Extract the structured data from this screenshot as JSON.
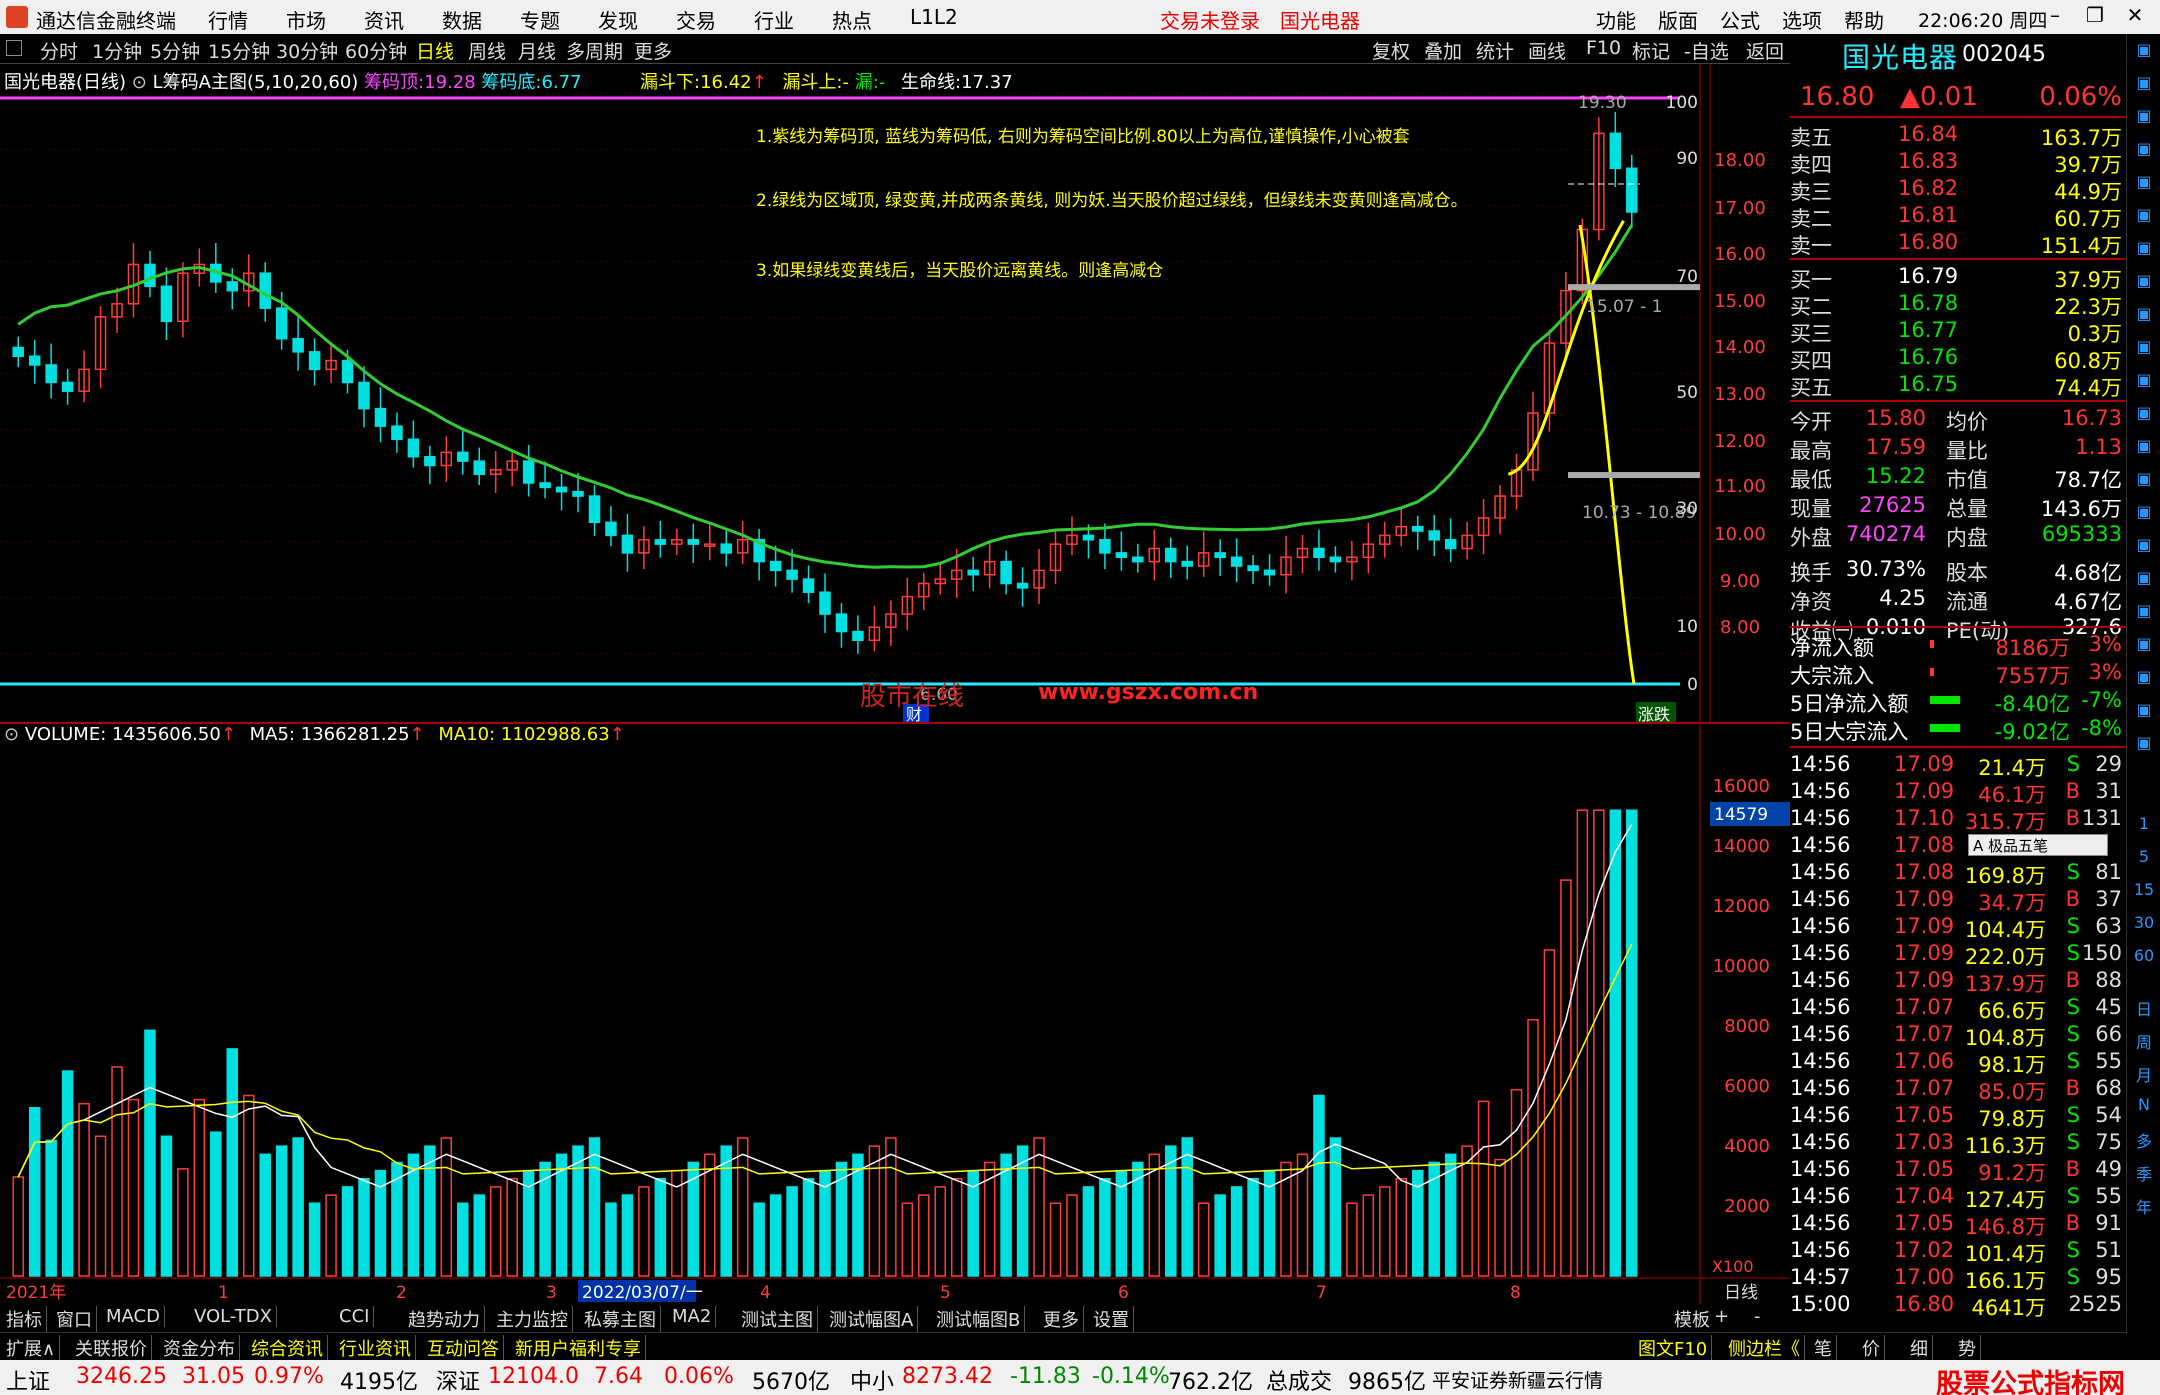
{
  "title_bar": {
    "app_name": "通达信金融终端",
    "menus": [
      "行情",
      "市场",
      "资讯",
      "数据",
      "专题",
      "发现",
      "交易",
      "行业",
      "热点",
      "L1L2"
    ],
    "status": "交易未登录",
    "stock": "国光电器",
    "right_menus": [
      "功能",
      "版面",
      "公式",
      "选项",
      "帮助"
    ],
    "time": "22:06:20",
    "weekday": "周四"
  },
  "toolbar": {
    "periods": [
      "分时",
      "1分钟",
      "5分钟",
      "15分钟",
      "30分钟",
      "60分钟",
      "日线",
      "周线",
      "月线",
      "多周期",
      "更多"
    ],
    "active": "日线",
    "right_buttons": [
      "复权",
      "叠加",
      "统计",
      "画线",
      "F10",
      "标记",
      "-自选",
      "返回"
    ]
  },
  "main_legend": {
    "stock_label": "国光电器(日线)",
    "indicator": "L筹码A主图(5,10,20,60)",
    "chip_top_label": "筹码顶:",
    "chip_top": "19.28",
    "chip_bottom_label": "筹码底:",
    "chip_bottom": "6.77",
    "funnel_low_label": "漏斗下:",
    "funnel_low": "16.42",
    "funnel_high": "漏斗上:-",
    "funnel": "漏:-",
    "life_line_label": "生命线:",
    "life_line": "17.37"
  },
  "notes": [
    "1.紫线为筹码顶, 蓝线为筹码低, 右则为筹码空间比例.80以上为高位,谨慎操作,小心被套",
    "2.绿线为区域顶, 绿变黄,并成两条黄线, 则为妖.当天股价超过绿线，但绿线未变黄则逢高减仓。",
    "3.如果绿线变黄线后，当天股价远离黄线。则逢高减仓"
  ],
  "main_annotations": {
    "peak": "19.30",
    "low": "6.60",
    "low_tag": "财",
    "mid_range": "10.73 - 10.89",
    "upper_range": "15.07 - 1",
    "end_tag": "涨跌",
    "watermark": "股市在线",
    "url": "www.gszx.com.cn"
  },
  "price_axis": [
    "18.00",
    "17.00",
    "16.00",
    "15.00",
    "14.00",
    "13.00",
    "12.00",
    "11.00",
    "10.00",
    "9.00",
    "8.00"
  ],
  "ratio_axis": [
    "100",
    "90",
    "70",
    "50",
    "30",
    "10",
    "0"
  ],
  "volume_legend": {
    "label": "VOLUME:",
    "value": "1435606.50",
    "ma5_label": "MA5:",
    "ma5": "1366281.25",
    "ma10_label": "MA10:",
    "ma10": "1102988.63"
  },
  "volume_axis": [
    "16000",
    "14000",
    "12000",
    "10000",
    "8000",
    "6000",
    "4000",
    "2000"
  ],
  "volume_badge": "14579",
  "volume_unit": "X100",
  "date_axis": [
    "2021年",
    "1",
    "2",
    "3",
    "2022/03/07/一",
    "4",
    "5",
    "6",
    "7",
    "8"
  ],
  "date_axis_label": "日线",
  "chart_data": {
    "type": "candlestick",
    "ylim": [
      6.0,
      19.5
    ],
    "note": "daily candles; price in yuan",
    "closes": [
      13.5,
      13.3,
      12.9,
      12.7,
      13.2,
      14.4,
      14.7,
      15.6,
      15.1,
      14.3,
      15.4,
      15.6,
      15.2,
      15.0,
      15.4,
      14.6,
      13.9,
      13.6,
      13.2,
      13.4,
      12.9,
      12.3,
      11.9,
      11.6,
      11.2,
      11.0,
      11.3,
      11.1,
      10.8,
      10.9,
      11.1,
      10.6,
      10.5,
      10.4,
      10.3,
      9.7,
      9.4,
      9.0,
      9.3,
      9.2,
      9.3,
      9.2,
      9.2,
      9.0,
      9.3,
      8.8,
      8.6,
      8.4,
      8.1,
      7.6,
      7.2,
      7.0,
      7.3,
      7.6,
      8.0,
      8.3,
      8.4,
      8.6,
      8.5,
      8.8,
      8.3,
      8.2,
      8.6,
      9.2,
      9.4,
      9.3,
      9.0,
      8.9,
      8.8,
      9.1,
      8.8,
      8.7,
      9.0,
      8.9,
      8.7,
      8.6,
      8.5,
      8.9,
      9.1,
      8.9,
      8.8,
      8.9,
      9.2,
      9.4,
      9.6,
      9.5,
      9.3,
      9.1,
      9.4,
      9.8,
      10.3,
      10.9,
      12.2,
      13.8,
      15.0,
      16.4,
      18.6,
      17.8,
      16.8
    ],
    "life_line_label": "生命线"
  },
  "quote": {
    "name": "国光电器",
    "code": "002045",
    "price": "16.80",
    "change": "▲0.01",
    "pct": "0.06%",
    "asks": [
      {
        "label": "卖五",
        "price": "16.84",
        "vol": "163.7万"
      },
      {
        "label": "卖四",
        "price": "16.83",
        "vol": "39.7万"
      },
      {
        "label": "卖三",
        "price": "16.82",
        "vol": "44.9万"
      },
      {
        "label": "卖二",
        "price": "16.81",
        "vol": "60.7万"
      },
      {
        "label": "卖一",
        "price": "16.80",
        "vol": "151.4万"
      }
    ],
    "bids": [
      {
        "label": "买一",
        "price": "16.79",
        "vol": "37.9万"
      },
      {
        "label": "买二",
        "price": "16.78",
        "vol": "22.3万"
      },
      {
        "label": "买三",
        "price": "16.77",
        "vol": "0.3万"
      },
      {
        "label": "买四",
        "price": "16.76",
        "vol": "60.8万"
      },
      {
        "label": "买五",
        "price": "16.75",
        "vol": "74.4万"
      }
    ],
    "stats": [
      {
        "l1": "今开",
        "v1": "15.80",
        "l2": "均价",
        "v2": "16.73"
      },
      {
        "l1": "最高",
        "v1": "17.59",
        "l2": "量比",
        "v2": "1.13"
      },
      {
        "l1": "最低",
        "v1": "15.22",
        "l2": "市值",
        "v2": "78.7亿"
      },
      {
        "l1": "现量",
        "v1": "27625",
        "l2": "总量",
        "v2": "143.6万"
      },
      {
        "l1": "外盘",
        "v1": "740274",
        "l2": "内盘",
        "v2": "695333"
      },
      {
        "l1": "换手",
        "v1": "30.73%",
        "l2": "股本",
        "v2": "4.68亿"
      },
      {
        "l1": "净资",
        "v1": "4.25",
        "l2": "流通",
        "v2": "4.67亿"
      },
      {
        "l1": "收益㈠",
        "v1": "0.010",
        "l2": "PE(动)",
        "v2": "327.6"
      }
    ],
    "flows": [
      {
        "label": "净流入额",
        "value": "8186万",
        "pct": "3%"
      },
      {
        "label": "大宗流入",
        "value": "7557万",
        "pct": "3%"
      },
      {
        "label": "5日净流入额",
        "value": "-8.40亿",
        "pct": "-7%"
      },
      {
        "label": "5日大宗流入",
        "value": "-9.02亿",
        "pct": "-8%"
      }
    ],
    "ticks": [
      {
        "t": "14:56",
        "p": "17.09",
        "v": "21.4万",
        "s": "S",
        "n": "29"
      },
      {
        "t": "14:56",
        "p": "17.09",
        "v": "46.1万",
        "s": "B",
        "n": "31"
      },
      {
        "t": "14:56",
        "p": "17.10",
        "v": "315.7万",
        "s": "B",
        "n": "131"
      },
      {
        "t": "14:56",
        "p": "17.08",
        "v": "",
        "s": "",
        "n": ""
      },
      {
        "t": "14:56",
        "p": "17.08",
        "v": "169.8万",
        "s": "S",
        "n": "81"
      },
      {
        "t": "14:56",
        "p": "17.09",
        "v": "34.7万",
        "s": "B",
        "n": "37"
      },
      {
        "t": "14:56",
        "p": "17.09",
        "v": "104.4万",
        "s": "S",
        "n": "63"
      },
      {
        "t": "14:56",
        "p": "17.09",
        "v": "222.0万",
        "s": "S",
        "n": "150"
      },
      {
        "t": "14:56",
        "p": "17.09",
        "v": "137.9万",
        "s": "B",
        "n": "88"
      },
      {
        "t": "14:56",
        "p": "17.07",
        "v": "66.6万",
        "s": "S",
        "n": "45"
      },
      {
        "t": "14:56",
        "p": "17.07",
        "v": "104.8万",
        "s": "S",
        "n": "66"
      },
      {
        "t": "14:56",
        "p": "17.06",
        "v": "98.1万",
        "s": "S",
        "n": "55"
      },
      {
        "t": "14:56",
        "p": "17.07",
        "v": "85.0万",
        "s": "B",
        "n": "68"
      },
      {
        "t": "14:56",
        "p": "17.05",
        "v": "79.8万",
        "s": "S",
        "n": "54"
      },
      {
        "t": "14:56",
        "p": "17.03",
        "v": "116.3万",
        "s": "S",
        "n": "75"
      },
      {
        "t": "14:56",
        "p": "17.05",
        "v": "91.2万",
        "s": "B",
        "n": "49"
      },
      {
        "t": "14:56",
        "p": "17.04",
        "v": "127.4万",
        "s": "S",
        "n": "55"
      },
      {
        "t": "14:56",
        "p": "17.05",
        "v": "146.8万",
        "s": "B",
        "n": "91"
      },
      {
        "t": "14:56",
        "p": "17.02",
        "v": "101.4万",
        "s": "S",
        "n": "51"
      },
      {
        "t": "14:57",
        "p": "17.00",
        "v": "166.1万",
        "s": "S",
        "n": "95"
      },
      {
        "t": "15:00",
        "p": "16.80",
        "v": "4641万",
        "s": "",
        "n": "2525"
      }
    ],
    "popup": "A 极品五笔"
  },
  "right_side_labels": [
    "日",
    "周",
    "月",
    "N",
    "多",
    "季",
    "年"
  ],
  "right_side_numbers": [
    "1",
    "5",
    "15",
    "30",
    "60"
  ],
  "tabs1": [
    "指标",
    "窗口",
    "MACD",
    "VOL-TDX",
    "CCI",
    "趋势动力",
    "主力监控",
    "私募主图",
    "MA2",
    "测试主图",
    "测试幅图A",
    "测试幅图B",
    "更多",
    "设置"
  ],
  "tabs1_right": [
    "模板",
    "+",
    "-"
  ],
  "tabs2": [
    "扩展∧",
    "关联报价",
    "资金分布",
    "综合资讯",
    "行业资讯",
    "互动问答",
    "新用户福利专享"
  ],
  "tabs2_right": [
    "图文F10",
    "侧边栏《",
    "笔",
    "价",
    "细",
    "势"
  ],
  "ticker": {
    "sh_label": "上证",
    "sh": "3246.25",
    "sh_chg": "31.05",
    "sh_pct": "0.97%",
    "sh_amt": "4195亿",
    "sz_label": "深证",
    "sz": "12104.0",
    "sz_chg": "7.64",
    "sz_pct": "0.06%",
    "sz_amt": "5670亿",
    "zx_label": "中小",
    "zx": "8273.42",
    "zx_chg": "-11.83",
    "zx_pct": "-0.14%",
    "zx_amt": "762.2亿",
    "total_label": "总成交",
    "total": "9865亿",
    "broker": "平安证券新疆云行情",
    "brand": "股票公式指标网"
  }
}
